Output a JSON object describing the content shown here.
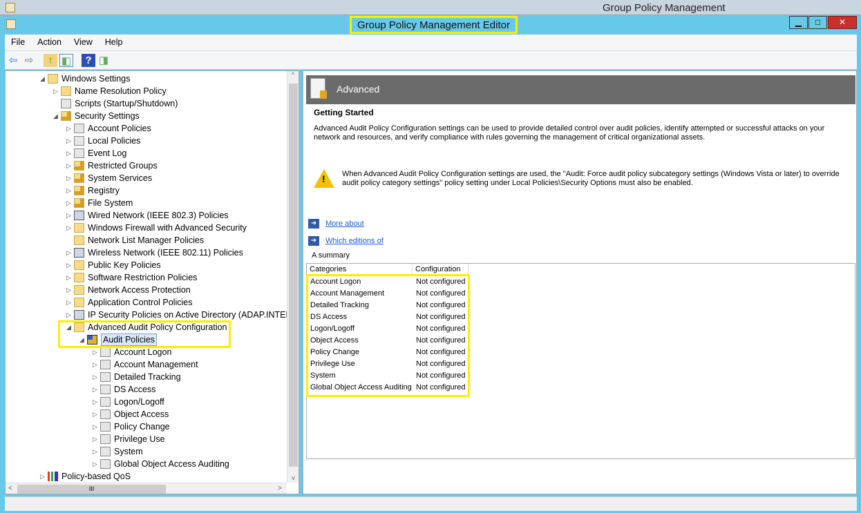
{
  "outer_title": "Group Policy Management",
  "window_title": "Group Policy Management Editor",
  "controls": {
    "minimize": "▁",
    "maximize": "□",
    "close": "✕"
  },
  "menu": [
    "File",
    "Action",
    "View",
    "Help"
  ],
  "toolbar": {
    "back": "⇦",
    "forward": "⇨",
    "up": "↑",
    "show_hide": "◧",
    "help": "?",
    "action_pane": "◨"
  },
  "tree": [
    {
      "label": "Windows Settings",
      "level": 0,
      "exp": "open",
      "icon": "folder"
    },
    {
      "label": "Name Resolution Policy",
      "level": 1,
      "exp": "closed",
      "icon": "folder"
    },
    {
      "label": "Scripts (Startup/Shutdown)",
      "level": 1,
      "exp": "none",
      "icon": "doc"
    },
    {
      "label": "Security Settings",
      "level": 1,
      "exp": "open",
      "icon": "lockfolder"
    },
    {
      "label": "Account Policies",
      "level": 2,
      "exp": "closed",
      "icon": "doc"
    },
    {
      "label": "Local Policies",
      "level": 2,
      "exp": "closed",
      "icon": "doc"
    },
    {
      "label": "Event Log",
      "level": 2,
      "exp": "closed",
      "icon": "doc"
    },
    {
      "label": "Restricted Groups",
      "level": 2,
      "exp": "closed",
      "icon": "lockfolder"
    },
    {
      "label": "System Services",
      "level": 2,
      "exp": "closed",
      "icon": "lockfolder"
    },
    {
      "label": "Registry",
      "level": 2,
      "exp": "closed",
      "icon": "lockfolder"
    },
    {
      "label": "File System",
      "level": 2,
      "exp": "closed",
      "icon": "lockfolder"
    },
    {
      "label": "Wired Network (IEEE 802.3) Policies",
      "level": 2,
      "exp": "closed",
      "icon": "net"
    },
    {
      "label": "Windows Firewall with Advanced Security",
      "level": 2,
      "exp": "closed",
      "icon": "folder"
    },
    {
      "label": "Network List Manager Policies",
      "level": 2,
      "exp": "none",
      "icon": "folder"
    },
    {
      "label": "Wireless Network (IEEE 802.11) Policies",
      "level": 2,
      "exp": "closed",
      "icon": "net"
    },
    {
      "label": "Public Key Policies",
      "level": 2,
      "exp": "closed",
      "icon": "folder"
    },
    {
      "label": "Software Restriction Policies",
      "level": 2,
      "exp": "closed",
      "icon": "folder"
    },
    {
      "label": "Network Access Protection",
      "level": 2,
      "exp": "closed",
      "icon": "folder"
    },
    {
      "label": "Application Control Policies",
      "level": 2,
      "exp": "closed",
      "icon": "folder"
    },
    {
      "label": "IP Security Policies on Active Directory (ADAP.INTERNAL)",
      "level": 2,
      "exp": "closed",
      "icon": "net"
    },
    {
      "label": "Advanced Audit Policy Configuration",
      "level": 2,
      "exp": "open",
      "icon": "folder"
    },
    {
      "label": "Audit Policies",
      "level": 3,
      "exp": "open",
      "icon": "policy",
      "selected": true
    },
    {
      "label": "Account Logon",
      "level": 4,
      "exp": "closed",
      "icon": "doc"
    },
    {
      "label": "Account Management",
      "level": 4,
      "exp": "closed",
      "icon": "doc"
    },
    {
      "label": "Detailed Tracking",
      "level": 4,
      "exp": "closed",
      "icon": "doc"
    },
    {
      "label": "DS Access",
      "level": 4,
      "exp": "closed",
      "icon": "doc"
    },
    {
      "label": "Logon/Logoff",
      "level": 4,
      "exp": "closed",
      "icon": "doc"
    },
    {
      "label": "Object Access",
      "level": 4,
      "exp": "closed",
      "icon": "doc"
    },
    {
      "label": "Policy Change",
      "level": 4,
      "exp": "closed",
      "icon": "doc"
    },
    {
      "label": "Privilege Use",
      "level": 4,
      "exp": "closed",
      "icon": "doc"
    },
    {
      "label": "System",
      "level": 4,
      "exp": "closed",
      "icon": "doc"
    },
    {
      "label": "Global Object Access Auditing",
      "level": 4,
      "exp": "closed",
      "icon": "doc"
    },
    {
      "label": "Policy-based QoS",
      "level": 0,
      "exp": "closed",
      "icon": "chart"
    }
  ],
  "right": {
    "banner": "Advanced",
    "heading": "Getting Started",
    "intro": "Advanced Audit Policy Configuration settings can be used to provide detailed control over audit policies, identify attempted or successful attacks on your network and resources, and verify compliance with rules governing the management of critical organizational assets.",
    "warning": "When Advanced Audit Policy Configuration settings are used, the \"Audit: Force audit policy subcategory settings (Windows Vista or later) to override audit policy category settings\" policy setting under Local Policies\\Security Options must also be enabled.",
    "links": [
      "More about",
      "Which editions of"
    ],
    "summary_label": "A summary",
    "columns": [
      "Categories",
      "Configuration"
    ],
    "rows": [
      [
        "Account Logon",
        "Not configured"
      ],
      [
        "Account Management",
        "Not configured"
      ],
      [
        "Detailed Tracking",
        "Not configured"
      ],
      [
        "DS Access",
        "Not configured"
      ],
      [
        "Logon/Logoff",
        "Not configured"
      ],
      [
        "Object Access",
        "Not configured"
      ],
      [
        "Policy Change",
        "Not configured"
      ],
      [
        "Privilege Use",
        "Not configured"
      ],
      [
        "System",
        "Not configured"
      ],
      [
        "Global Object Access Auditing",
        "Not configured"
      ]
    ]
  },
  "scroll": {
    "hthumb_glyph": "III",
    "up": "^",
    "down": "v",
    "left": "<",
    "right": ">"
  }
}
